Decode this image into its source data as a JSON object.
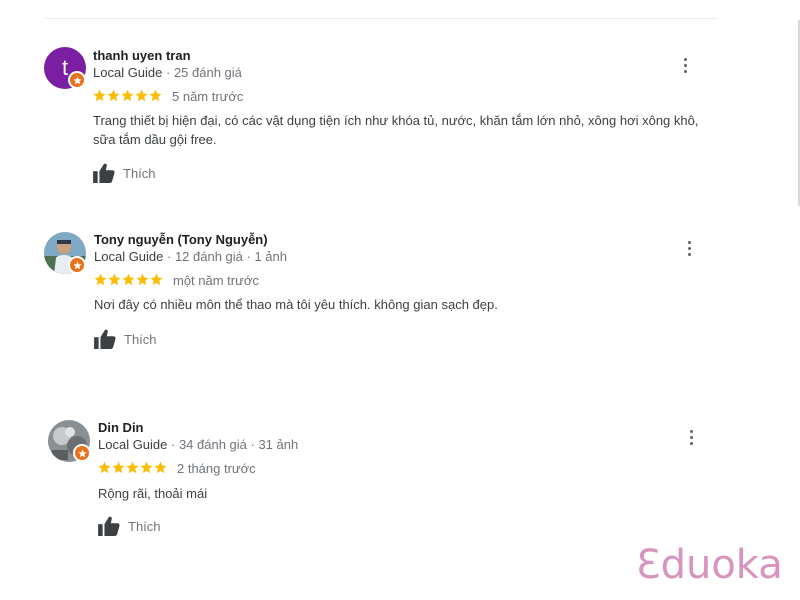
{
  "reviews": [
    {
      "avatar_letter": "t",
      "avatar_color": "#7b1fa2",
      "name": "thanh uyen tran",
      "guide_label": "Local Guide",
      "stats": " · 25 đánh giá",
      "rating": 5,
      "time": "5 năm trước",
      "text": "Trang thiết bị hiện đại, có các vật dụng tiện ích như khóa tủ, nước, khăn tắm lớn nhỏ, xông hơi xông khô, sữa tắm dầu gội free.",
      "like_label": "Thích"
    },
    {
      "avatar_letter": "",
      "name": "Tony nguyễn (Tony Nguyễn)",
      "guide_label": "Local Guide",
      "stats": " · 12 đánh giá · 1 ảnh",
      "rating": 5,
      "time": "một năm trước",
      "text": "Nơi đây có nhiều môn thể thao mà tôi yêu thích. không gian sạch đẹp.",
      "like_label": "Thích"
    },
    {
      "avatar_letter": "",
      "name": "Din Din",
      "guide_label": "Local Guide",
      "stats": " · 34 đánh giá · 31 ảnh",
      "rating": 5,
      "time": "2 tháng trước",
      "text": "Rộng rãi, thoải mái",
      "like_label": "Thích"
    }
  ],
  "star_color": "#fbbc04",
  "badge_color": "#e8711a",
  "watermark": "Ɛduoka"
}
